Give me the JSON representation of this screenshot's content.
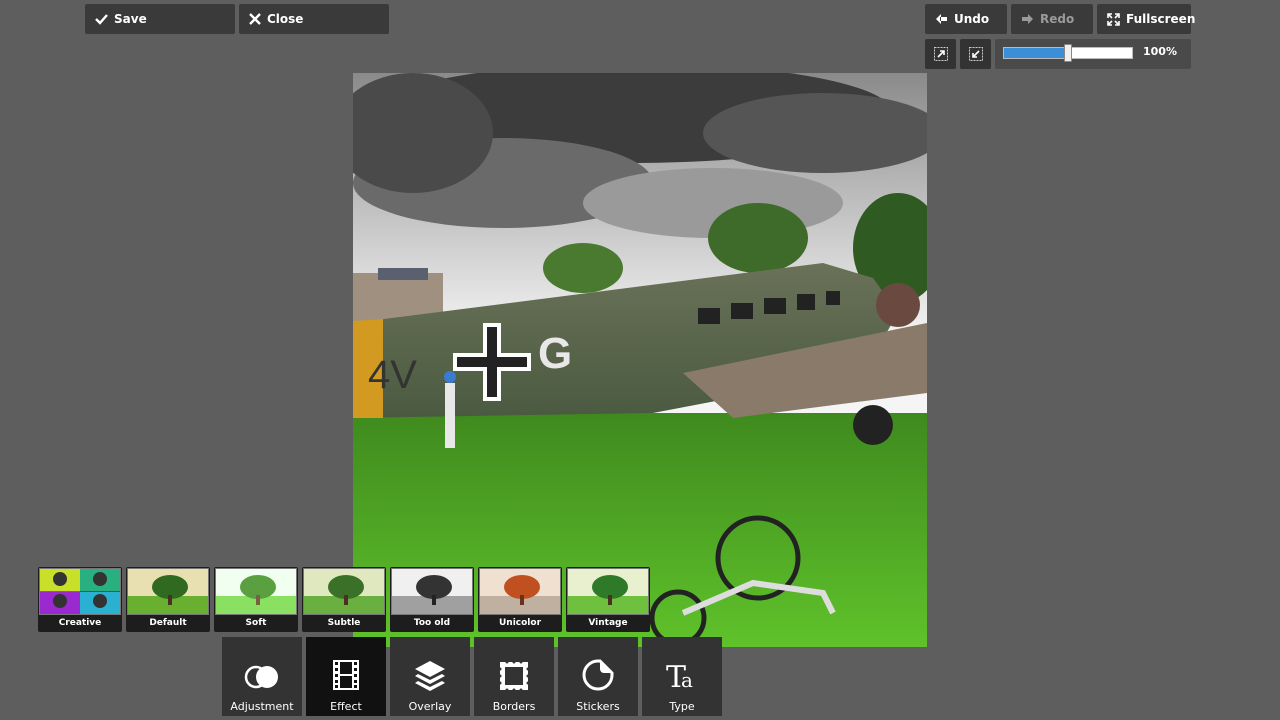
{
  "toolbar": {
    "save_label": "Save",
    "close_label": "Close",
    "undo_label": "Undo",
    "redo_label": "Redo",
    "fullscreen_label": "Fullscreen"
  },
  "zoom": {
    "level_label": "100%",
    "slider_fraction": 0.5
  },
  "effects": [
    {
      "label": "Creative"
    },
    {
      "label": "Default"
    },
    {
      "label": "Soft"
    },
    {
      "label": "Subtle"
    },
    {
      "label": "Too old"
    },
    {
      "label": "Unicolor"
    },
    {
      "label": "Vintage"
    }
  ],
  "tools": [
    {
      "label": "Adjustment",
      "icon": "adjustment-icon"
    },
    {
      "label": "Effect",
      "icon": "film-icon"
    },
    {
      "label": "Overlay",
      "icon": "layers-icon"
    },
    {
      "label": "Borders",
      "icon": "border-frame-icon"
    },
    {
      "label": "Stickers",
      "icon": "sticker-icon"
    },
    {
      "label": "Type",
      "icon": "text-icon"
    }
  ],
  "colors": {
    "background": "#5e5e5e",
    "button": "#3a3a3a",
    "accent": "#3a8fd8"
  }
}
